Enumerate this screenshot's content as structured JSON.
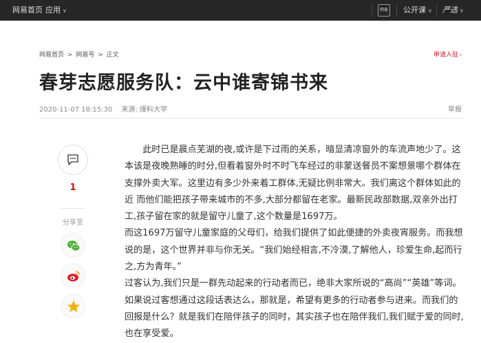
{
  "topbar": {
    "home": "网易首页",
    "apps": "应用",
    "phone_icon_text": "网易",
    "open_course": "公开课",
    "yanxuan": "严选"
  },
  "breadcrumb": {
    "items": [
      "网易首页",
      "网易号",
      "正文"
    ],
    "separator": ">"
  },
  "apply": "申请入驻",
  "article": {
    "title": "春芽志愿服务队：云中谁寄锦书来",
    "date": "2020-11-07 18:15:30",
    "source": "来源: 爆料大学",
    "report": "举报",
    "paragraphs": [
      "此时已是晨点芜湖的夜,或许是下过雨的关系，暗显清凉窗外的车流声地少了。这本该是夜晚熟睡的时分,但看着窗外时不时飞车经过的非蒙送餐员不案想景哪个群体在支撑外卖大军。这里边有多少外来着工群体,无疑比例非常大。我们离这个群体如此的近 而他们能把孩子带来城市的不多,大部分都留在老家。最新民政部数据,双亲外出打工,孩子留在家的就是留守儿童了,这个数量是1697万。",
      "而这1697万留守儿童家庭的父母们，给我们提供了如此便捷的外卖夜宵服务。而我想说的是，这个世界并非与你无关。“我们始经相言,不冷漠,了解他人，珍爱生命,起而行之,方为青年。”",
      "过客认为,我们只是一群先动起来的行动者而已，绝非大家所说的“高尚”“英雄”等词。如果说过客想通过这段话表达么，那就是，希望有更多的行动者参与进来。而我们的回报是什么？就是我们在陪伴孩子的同时，其实孩子也在陪伴我们,我们赋于爱的同时,也在享受爱。"
    ]
  },
  "sidebar": {
    "comment_count": "1",
    "share_label": "分享至"
  },
  "colors": {
    "topbar_bg": "#262626",
    "accent_red": "#c8151d",
    "wechat_green": "#4eb13a",
    "weibo_red": "#e6162d",
    "star_yellow": "#f0b400"
  }
}
